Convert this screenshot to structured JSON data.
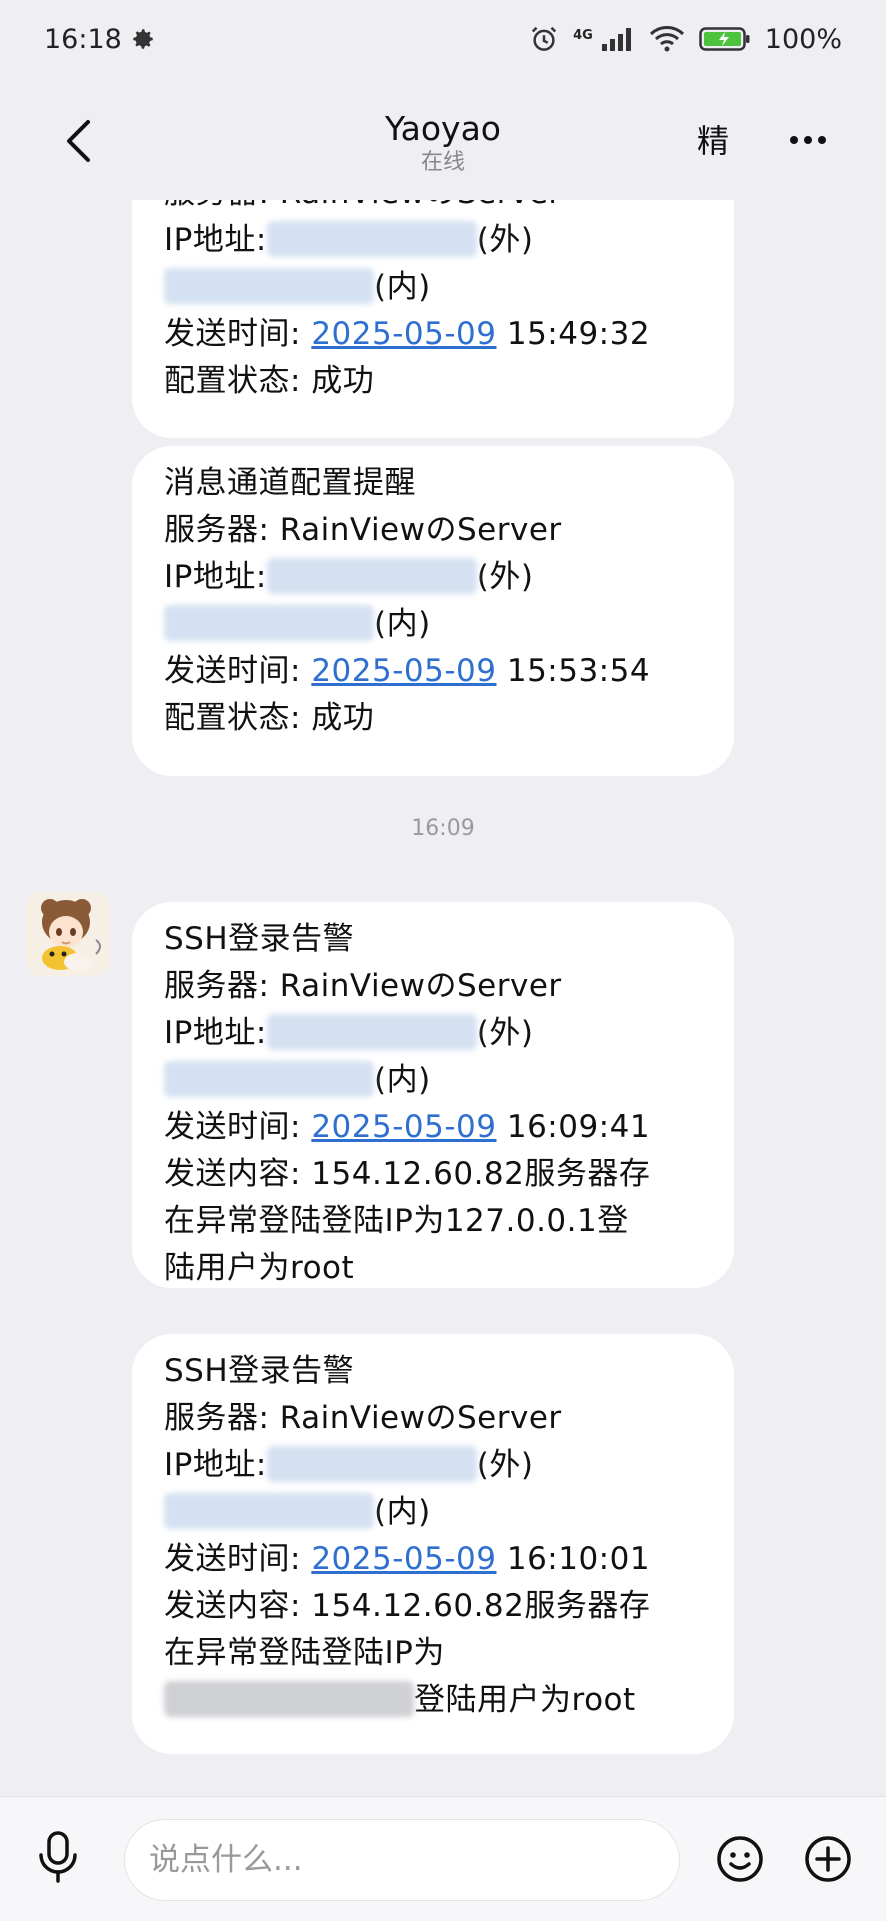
{
  "status_bar": {
    "time": "16:18",
    "network": "4G",
    "battery": "100%"
  },
  "header": {
    "title": "Yaoyao",
    "subtitle": "在线",
    "featured_label": "精"
  },
  "messages": [
    {
      "lines": {
        "server": "服务器: RainViewのServer",
        "ip_label": "IP地址:",
        "ext": "(外)",
        "int": "(内)",
        "time_label": "发送时间:",
        "date": "2025-05-09",
        "time": "15:49:32",
        "status": "配置状态: 成功"
      }
    },
    {
      "lines": {
        "title": "消息通道配置提醒",
        "server": "服务器: RainViewのServer",
        "ip_label": "IP地址:",
        "ext": "(外)",
        "int": "(内)",
        "time_label": "发送时间:",
        "date": "2025-05-09",
        "time": "15:53:54",
        "status": "配置状态: 成功"
      }
    },
    {
      "lines": {
        "title": "SSH登录告警",
        "server": "服务器: RainViewのServer",
        "ip_label": "IP地址:",
        "ext": "(外)",
        "int": "(内)",
        "time_label": "发送时间:",
        "date": "2025-05-09",
        "time": "16:09:41",
        "content_1": "发送内容: 154.12.60.82服务器存",
        "content_2": "在异常登陆登陆IP为127.0.0.1登",
        "content_3": "陆用户为root"
      }
    },
    {
      "lines": {
        "title": "SSH登录告警",
        "server": "服务器: RainViewのServer",
        "ip_label": "IP地址:",
        "ext": "(外)",
        "int": "(内)",
        "time_label": "发送时间:",
        "date": "2025-05-09",
        "time": "16:10:01",
        "content_1": "发送内容: 154.12.60.82服务器存",
        "content_2": "在异常登陆登陆IP为",
        "content_3": "登陆用户为root"
      }
    }
  ],
  "timestamp_divider": "16:09",
  "input": {
    "placeholder": "说点什么..."
  }
}
